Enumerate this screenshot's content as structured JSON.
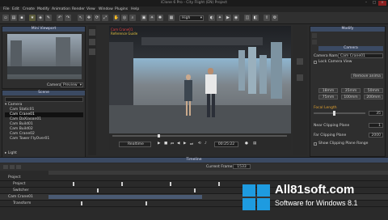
{
  "window": {
    "title": "iClone 6 Pro - City Flight (EN) Project"
  },
  "menu": [
    "File",
    "Edit",
    "Create",
    "Modify",
    "Animation",
    "Render",
    "View",
    "Window",
    "Plugins",
    "Help"
  ],
  "toolbar": {
    "quality": "High"
  },
  "mini_viewport": {
    "title": "Mini Viewport",
    "camera_label": "Camera",
    "camera_value": "Preview"
  },
  "scene_panel": {
    "title": "Scene",
    "items": [
      "Camera",
      "Cam Static01",
      "Cam Crane01",
      "Cam DaXiaoan01",
      "Cam Build01",
      "Cam Build02",
      "Cam Crane02",
      "Cam Tower FlyOver01",
      "Light"
    ],
    "selected_index": 2
  },
  "viewport": {
    "hud_line1": "Cam Crane01",
    "hud_line2": "Reference Guide"
  },
  "playback": {
    "mode": "Realtime",
    "time": "00:25:22"
  },
  "modify": {
    "title": "Modify",
    "section": "Camera",
    "camera_name_label": "Camera Name",
    "camera_name_value": "Cam Crane01",
    "lock_label": "Lock Camera View",
    "remove_label": "Remove anima",
    "lens_values": [
      "18mm",
      "35mm",
      "50mm",
      "75mm",
      "100mm",
      "200mm"
    ],
    "focal_label": "Focal Length",
    "focal_value": "35",
    "near_label": "Near Clipping Plane",
    "near_value": "1",
    "far_label": "Far Clipping Plane",
    "far_value": "2000",
    "show_label": "Show Clipping Plane Range"
  },
  "timeline": {
    "title": "Timeline",
    "current_frame_label": "Current Frame",
    "current_frame": "1533",
    "rows": [
      "Project",
      "Project",
      "Switcher",
      "Cam Crane01",
      "Transform"
    ]
  },
  "watermark": {
    "line1": "All81soft.com",
    "line2": "Software for Windows 8.1"
  }
}
